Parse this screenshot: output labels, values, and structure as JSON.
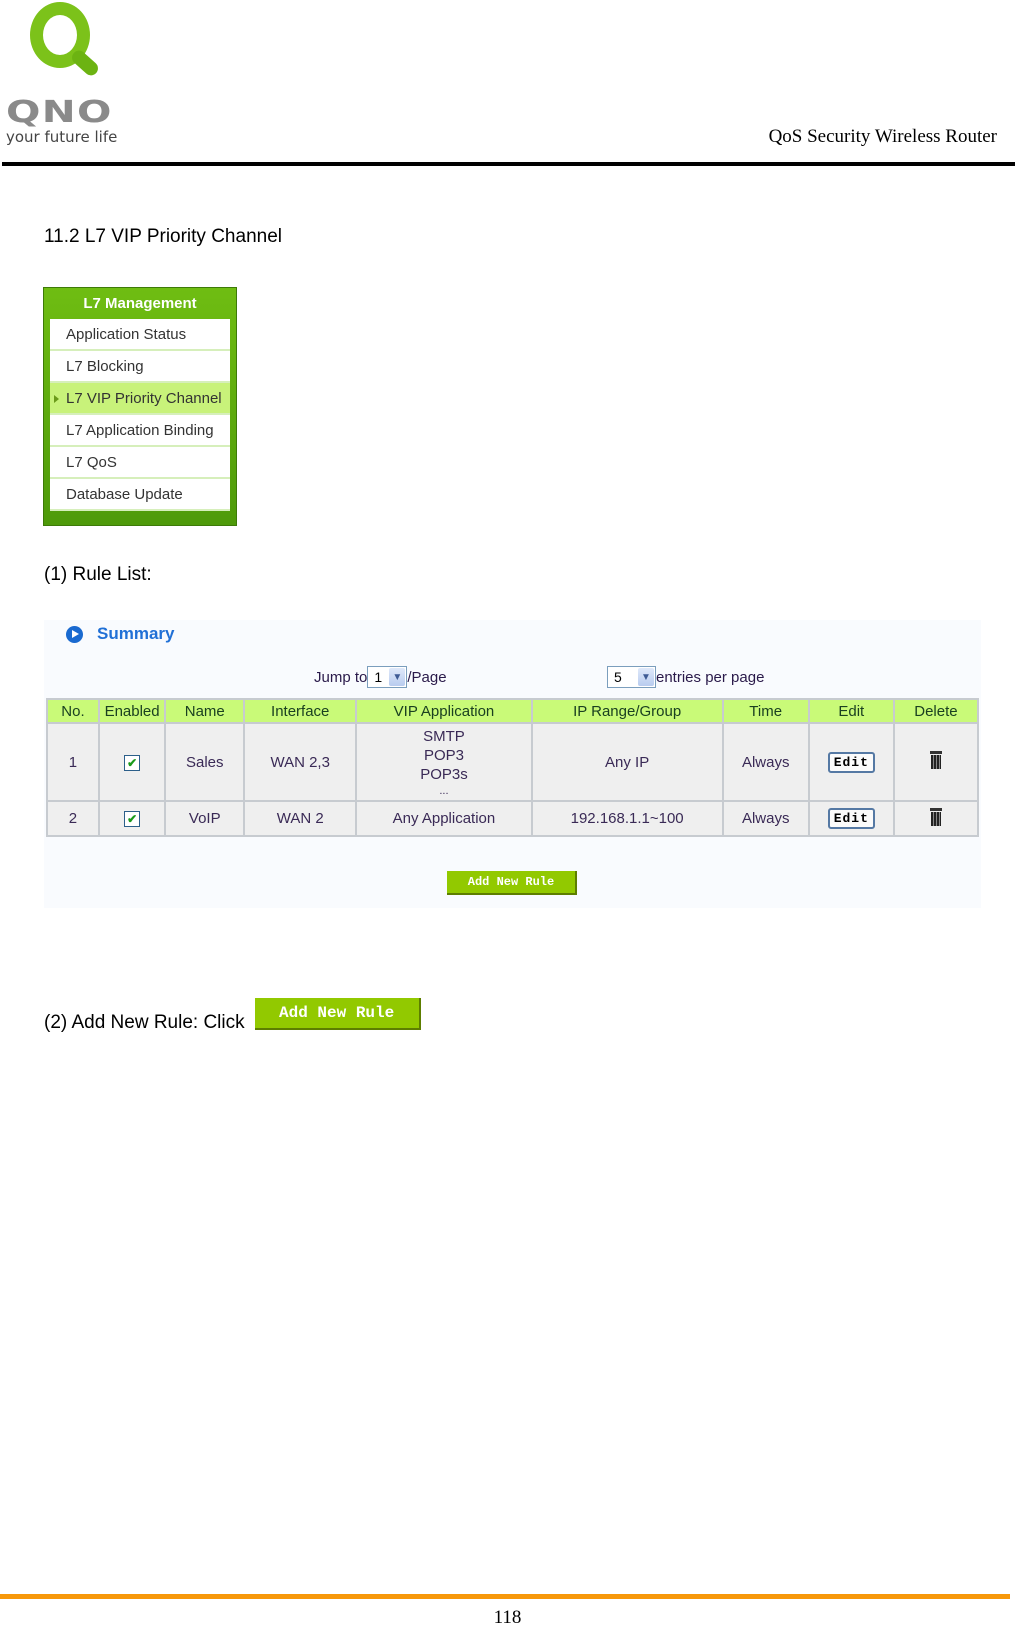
{
  "header": {
    "logo_wordmark": "QNO",
    "logo_tagline": "your future life",
    "doc_title": "QoS Security Wireless Router"
  },
  "section": {
    "title": "11.2 L7 VIP Priority Channel"
  },
  "menu": {
    "title": "L7 Management",
    "items": [
      {
        "label": "Application Status",
        "active": false
      },
      {
        "label": "L7 Blocking",
        "active": false
      },
      {
        "label": "L7 VIP Priority Channel",
        "active": true
      },
      {
        "label": "L7 Application Binding",
        "active": false
      },
      {
        "label": "L7 QoS",
        "active": false
      },
      {
        "label": "Database Update",
        "active": false
      }
    ]
  },
  "rule_list": {
    "step_label": "(1)  Rule List:",
    "summary_label": "Summary",
    "jump_to_label": "Jump to",
    "jump_to_value": "1",
    "page_label": "/Page",
    "entries_value": "5",
    "entries_label": "entries per page",
    "columns": [
      "No.",
      "Enabled",
      "Name",
      "Interface",
      "VIP Application",
      "IP Range/Group",
      "Time",
      "Edit",
      "Delete"
    ],
    "rows": [
      {
        "no": "1",
        "enabled": true,
        "name": "Sales",
        "interface": "WAN 2,3",
        "vip_application": [
          "SMTP",
          "POP3",
          "POP3s",
          "..."
        ],
        "ip_range": "Any IP",
        "time": "Always",
        "edit_label": "Edit"
      },
      {
        "no": "2",
        "enabled": true,
        "name": "VoIP",
        "interface": "WAN 2",
        "vip_application": [
          "Any Application"
        ],
        "ip_range": "192.168.1.1~100",
        "time": "Always",
        "edit_label": "Edit"
      }
    ],
    "add_new_rule_label": "Add New Rule"
  },
  "step2": {
    "text": "(2)  Add New Rule: Click",
    "button_label": "Add New Rule"
  },
  "footer": {
    "page_number": "118"
  },
  "colors": {
    "menu_green": "#6fbd12",
    "menu_active": "#c8f27a",
    "table_header": "#c9fa78",
    "button_green": "#92c900",
    "summary_blue": "#2170d6",
    "footer_orange": "#f7980a"
  }
}
